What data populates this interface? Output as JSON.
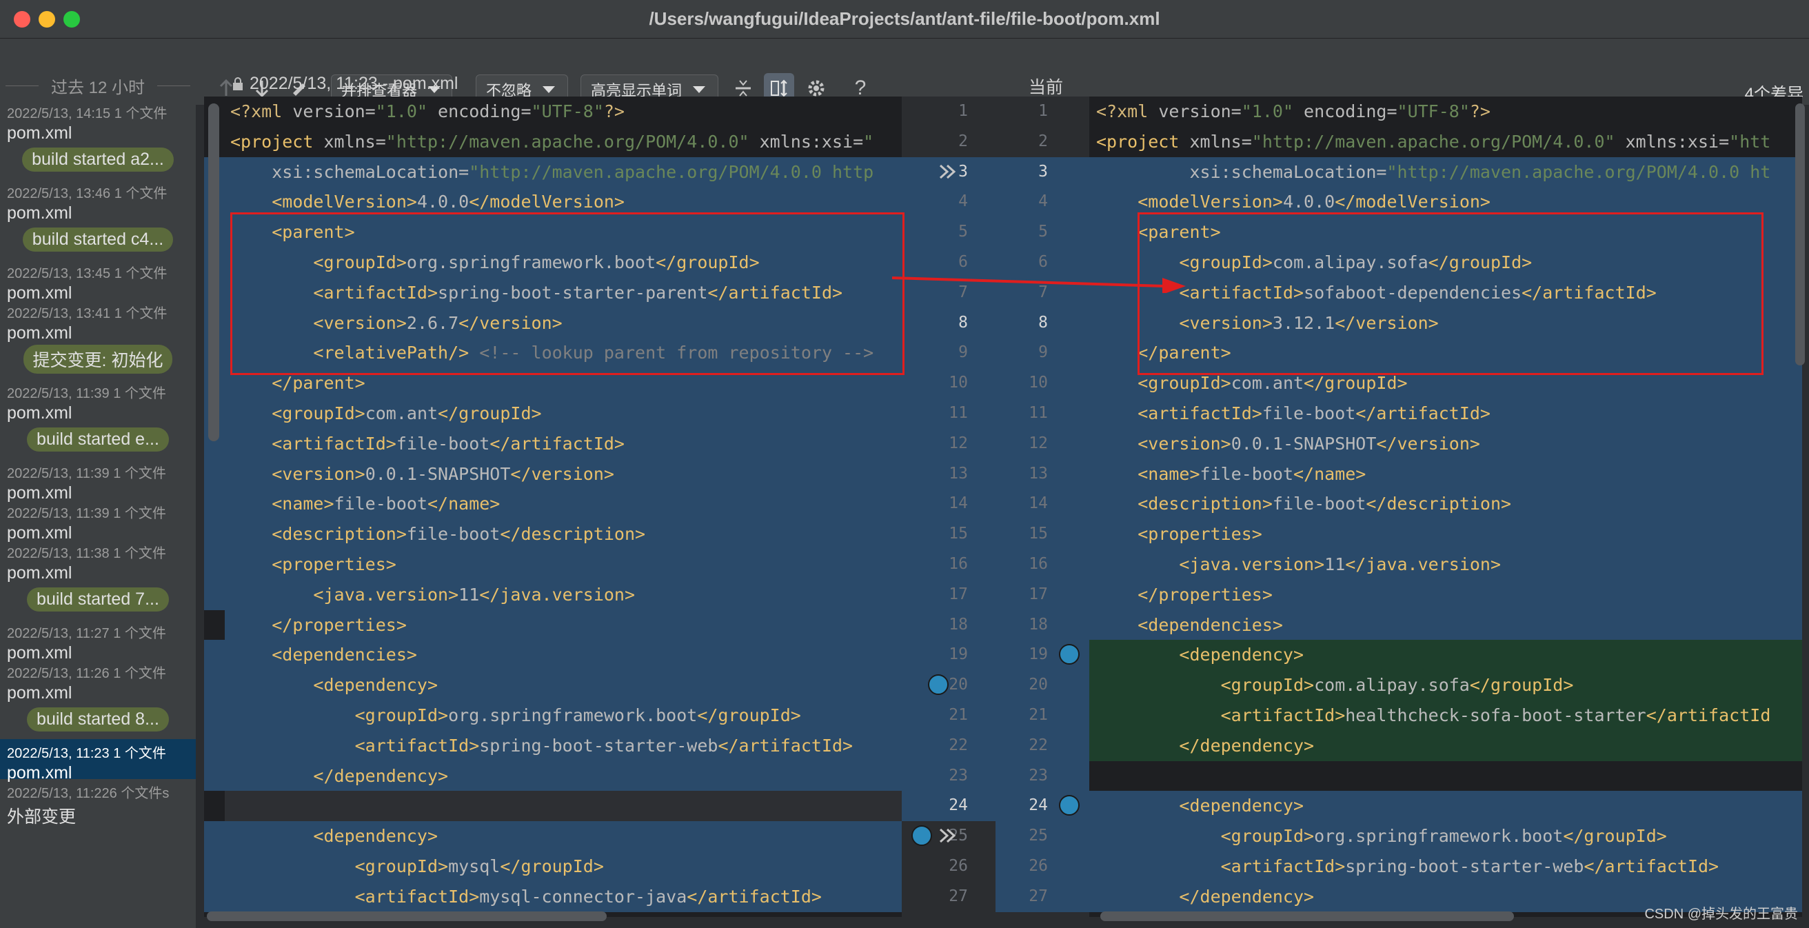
{
  "window": {
    "title": "/Users/wangfugui/IdeaProjects/ant/ant-file/file-boot/pom.xml"
  },
  "toolbar": {
    "viewer_label": "并排查看器",
    "ignore_label": "不忽略",
    "highlight_label": "高亮显示单词",
    "diff_count": "4个差异",
    "help_glyph": "?"
  },
  "history": {
    "header": "过去 12 小时",
    "items": [
      {
        "kind": "file",
        "meta": "2022/5/13, 14:15  1 个文件",
        "name": "pom.xml"
      },
      {
        "kind": "badge",
        "label": "build started a2..."
      },
      {
        "kind": "file",
        "meta": "2022/5/13, 13:46  1 个文件",
        "name": "pom.xml"
      },
      {
        "kind": "badge",
        "label": "build started c4..."
      },
      {
        "kind": "file",
        "meta": "2022/5/13, 13:45  1 个文件",
        "name": "pom.xml"
      },
      {
        "kind": "file",
        "meta": "2022/5/13, 13:41  1 个文件",
        "name": "pom.xml"
      },
      {
        "kind": "badge",
        "label": "提交变更: 初始化"
      },
      {
        "kind": "file",
        "meta": "2022/5/13, 11:39  1 个文件",
        "name": "pom.xml"
      },
      {
        "kind": "badge",
        "label": "build started e..."
      },
      {
        "kind": "file",
        "meta": "2022/5/13, 11:39  1 个文件",
        "name": "pom.xml"
      },
      {
        "kind": "file",
        "meta": "2022/5/13, 11:39  1 个文件",
        "name": "pom.xml"
      },
      {
        "kind": "file",
        "meta": "2022/5/13, 11:38  1 个文件",
        "name": "pom.xml"
      },
      {
        "kind": "badge",
        "label": "build started 7..."
      },
      {
        "kind": "file",
        "meta": "2022/5/13, 11:27  1 个文件",
        "name": "pom.xml"
      },
      {
        "kind": "file",
        "meta": "2022/5/13, 11:26  1 个文件",
        "name": "pom.xml"
      },
      {
        "kind": "badge",
        "label": "build started 8..."
      },
      {
        "kind": "file",
        "meta": "2022/5/13, 11:23  1 个文件",
        "name": "pom.xml",
        "selected": true
      },
      {
        "kind": "file",
        "meta": "2022/5/13, 11:226 个文件s",
        "name": "外部变更"
      }
    ]
  },
  "left_header": "2022/5/13, 11:23 - pom.xml",
  "right_header": "当前",
  "gutter": {
    "left_numbers": [
      "1",
      "2",
      "3",
      "4",
      "5",
      "6",
      "7",
      "8",
      "9",
      "10",
      "11",
      "12",
      "13",
      "14",
      "15",
      "16",
      "17",
      "18",
      "19",
      "20",
      "21",
      "22",
      "23",
      "24",
      "25",
      "26",
      "27"
    ],
    "right_numbers": [
      "1",
      "2",
      "3",
      "4",
      "5",
      "6",
      "7",
      "8",
      "9",
      "10",
      "11",
      "12",
      "13",
      "14",
      "15",
      "16",
      "17",
      "18",
      "19",
      "20",
      "21",
      "22",
      "23",
      "24",
      "25",
      "26",
      "27"
    ]
  },
  "left_code": [
    "<?xml version=\"1.0\" encoding=\"UTF-8\"?>",
    "<project xmlns=\"http://maven.apache.org/POM/4.0.0\" xmlns:xsi=\"",
    "    xsi:schemaLocation=\"http://maven.apache.org/POM/4.0.0 http",
    "    <modelVersion>4.0.0</modelVersion>",
    "    <parent>",
    "        <groupId>org.springframework.boot</groupId>",
    "        <artifactId>spring-boot-starter-parent</artifactId>",
    "        <version>2.6.7</version>",
    "        <relativePath/> <!-- lookup parent from repository -->",
    "    </parent>",
    "    <groupId>com.ant</groupId>",
    "    <artifactId>file-boot</artifactId>",
    "    <version>0.0.1-SNAPSHOT</version>",
    "    <name>file-boot</name>",
    "    <description>file-boot</description>",
    "    <properties>",
    "        <java.version>11</java.version>",
    "    </properties>",
    "    <dependencies>",
    "        <dependency>",
    "            <groupId>org.springframework.boot</groupId>",
    "            <artifactId>spring-boot-starter-web</artifactId>",
    "        </dependency>",
    "",
    "        <dependency>",
    "            <groupId>mysql</groupId>",
    "            <artifactId>mysql-connector-java</artifactId>"
  ],
  "right_code": [
    "<?xml version=\"1.0\" encoding=\"UTF-8\"?>",
    "<project xmlns=\"http://maven.apache.org/POM/4.0.0\" xmlns:xsi=\"htt",
    "         xsi:schemaLocation=\"http://maven.apache.org/POM/4.0.0 ht",
    "    <modelVersion>4.0.0</modelVersion>",
    "    <parent>",
    "        <groupId>com.alipay.sofa</groupId>",
    "        <artifactId>sofaboot-dependencies</artifactId>",
    "        <version>3.12.1</version>",
    "    </parent>",
    "    <groupId>com.ant</groupId>",
    "    <artifactId>file-boot</artifactId>",
    "    <version>0.0.1-SNAPSHOT</version>",
    "    <name>file-boot</name>",
    "    <description>file-boot</description>",
    "    <properties>",
    "        <java.version>11</java.version>",
    "    </properties>",
    "    <dependencies>",
    "        <dependency>",
    "            <groupId>com.alipay.sofa</groupId>",
    "            <artifactId>healthcheck-sofa-boot-starter</artifactId",
    "        </dependency>",
    "",
    "        <dependency>",
    "            <groupId>org.springframework.boot</groupId>",
    "            <artifactId>spring-boot-starter-web</artifactId>",
    "        </dependency>"
  ],
  "watermark": "CSDN @掉头发的王富贵",
  "colors": {
    "annotation_red": "#e01e1e",
    "changed_bg": "#2a4a6a",
    "added_bg": "#1e3f2c",
    "selection": "#0d3a5c"
  }
}
